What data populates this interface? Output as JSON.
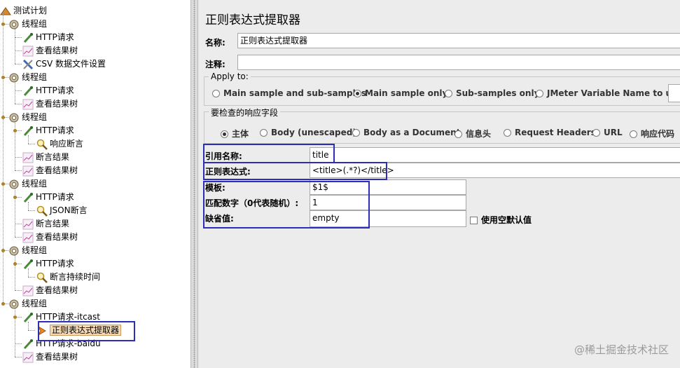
{
  "tree": {
    "root": "测试计划",
    "groups": [
      {
        "label": "线程组",
        "children": [
          {
            "label": "HTTP请求",
            "icon": "pipette-icon"
          },
          {
            "label": "查看结果树",
            "icon": "chart-icon"
          },
          {
            "label": "CSV 数据文件设置",
            "icon": "tools-icon"
          }
        ]
      },
      {
        "label": "线程组",
        "children": [
          {
            "label": "HTTP请求",
            "icon": "pipette-icon"
          },
          {
            "label": "查看结果树",
            "icon": "chart-icon"
          }
        ]
      },
      {
        "label": "线程组",
        "children": [
          {
            "label": "HTTP请求",
            "icon": "pipette-icon",
            "children": [
              {
                "label": "响应断言",
                "icon": "magnifier-icon"
              }
            ]
          },
          {
            "label": "断言结果",
            "icon": "chart-icon"
          },
          {
            "label": "查看结果树",
            "icon": "chart-icon"
          }
        ]
      },
      {
        "label": "线程组",
        "children": [
          {
            "label": "HTTP请求",
            "icon": "pipette-icon",
            "children": [
              {
                "label": "JSON断言",
                "icon": "magnifier-icon"
              }
            ]
          },
          {
            "label": "断言结果",
            "icon": "chart-icon"
          },
          {
            "label": "查看结果树",
            "icon": "chart-icon"
          }
        ]
      },
      {
        "label": "线程组",
        "children": [
          {
            "label": "HTTP请求",
            "icon": "pipette-icon",
            "children": [
              {
                "label": "断言持续时间",
                "icon": "magnifier-icon"
              }
            ]
          },
          {
            "label": "查看结果树",
            "icon": "chart-icon"
          }
        ]
      },
      {
        "label": "线程组",
        "children": [
          {
            "label": "HTTP请求-itcast",
            "icon": "pipette-icon",
            "children": [
              {
                "label": "正则表达式提取器",
                "icon": "arrow-icon",
                "selected": true
              }
            ]
          },
          {
            "label": "HTTP请求-baidu",
            "icon": "pipette-icon"
          },
          {
            "label": "查看结果树",
            "icon": "chart-icon"
          }
        ]
      }
    ]
  },
  "panel": {
    "title": "正则表达式提取器",
    "name_label": "名称:",
    "name_value": "正则表达式提取器",
    "comment_label": "注释:",
    "comment_value": "",
    "apply_to": {
      "title": "Apply to:",
      "options": [
        "Main sample and sub-samples",
        "Main sample only",
        "Sub-samples only",
        "JMeter Variable Name to use"
      ],
      "selected": "Main sample only"
    },
    "response_field": {
      "title": "要检查的响应字段",
      "options": [
        "主体",
        "Body (unescaped)",
        "Body as a Document",
        "信息头",
        "Request Headers",
        "URL",
        "响应代码"
      ],
      "selected": "主体"
    },
    "ref_name_label": "引用名称:",
    "ref_name_value": "title",
    "regex_label": "正则表达式:",
    "regex_value": "<title>(.*?)</title>",
    "template_label": "模板:",
    "template_value": "$1$",
    "match_no_label": "匹配数字（0代表随机）:",
    "match_no_value": "1",
    "default_label": "缺省值:",
    "default_value": "empty",
    "use_empty_label": "使用空默认值"
  },
  "colors": {
    "highlight": "#2d2db8",
    "selected_bg": "#f4d9b4",
    "panel_bg": "#ececec"
  },
  "watermark": "@稀土掘金技术社区"
}
